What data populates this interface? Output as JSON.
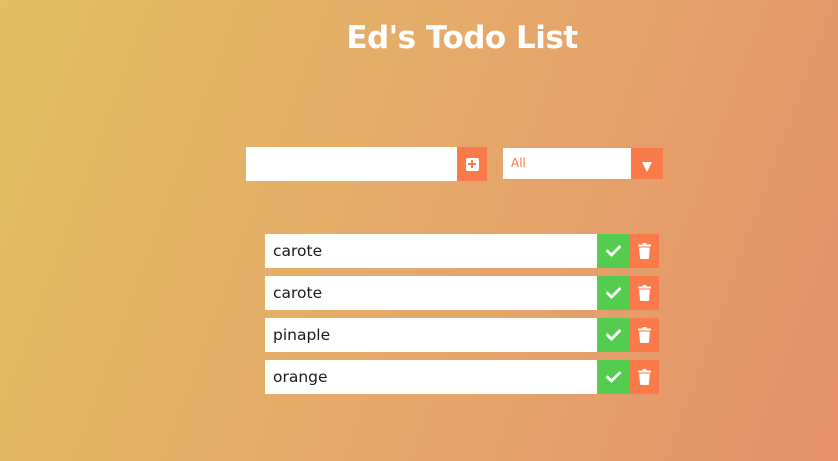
{
  "header": {
    "title": "Ed's Todo List"
  },
  "form": {
    "input_value": "",
    "input_placeholder": "",
    "add_icon": "plus-square-icon"
  },
  "filter": {
    "selected": "All",
    "arrow_icon": "caret-down-icon"
  },
  "todos": [
    {
      "text": "carote",
      "complete_icon": "check-icon",
      "delete_icon": "trash-icon"
    },
    {
      "text": "carote",
      "complete_icon": "check-icon",
      "delete_icon": "trash-icon"
    },
    {
      "text": "pinaple",
      "complete_icon": "check-icon",
      "delete_icon": "trash-icon"
    },
    {
      "text": "orange",
      "complete_icon": "check-icon",
      "delete_icon": "trash-icon"
    }
  ],
  "colors": {
    "background_start": "#e2bf62",
    "background_end": "#e5916b",
    "accent": "#fb7a4a",
    "complete": "#54cd4e",
    "title": "#ffffff"
  }
}
